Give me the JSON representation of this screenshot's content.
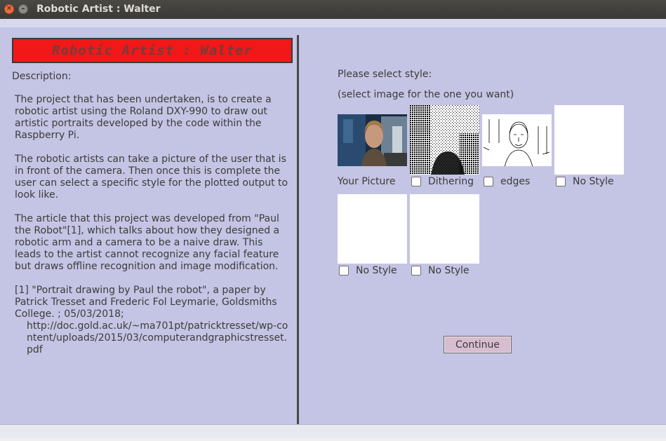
{
  "window": {
    "title": "Robotic Artist : Walter"
  },
  "banner": {
    "title": "Robotic Artist : Walter"
  },
  "description": {
    "label": "Description:",
    "paragraphs": [
      "The project that has been undertaken, is to create a robotic artist using the Roland DXY-990 to draw out artistic portraits developed by the code within the Raspberry Pi.",
      "The robotic artists can take a picture of the user that is in front of the camera. Then once this is complete the user can select a specific style for the plotted output to look like.",
      "The article that this project was developed from \"Paul the Robot\"[1], which talks about how they designed a robotic arm and a camera to be a naive draw. This leads to the artist cannot recognize any facial feature but draws offline recognition and image modification."
    ],
    "reference": "[1] \"Portrait drawing by Paul the robot\", a paper by Patrick Tresset and Frederic Fol Leymarie, Goldsmiths College. ; 05/03/2018;",
    "reference_url": "http://doc.gold.ac.uk/~ma701pt/patricktresset/wp-content/uploads/2015/03/computerandgraphicstresset.pdf"
  },
  "style_select": {
    "prompt": "Please select style:",
    "hint": "(select image for the one you want)",
    "options": [
      {
        "label": "Your Picture",
        "checkbox": false
      },
      {
        "label": "Dithering",
        "checkbox": true,
        "checked": false
      },
      {
        "label": "edges",
        "checkbox": true,
        "checked": false
      },
      {
        "label": "No Style",
        "checkbox": true,
        "checked": false
      },
      {
        "label": "No Style",
        "checkbox": true,
        "checked": false
      },
      {
        "label": "No Style",
        "checkbox": true,
        "checked": false
      }
    ]
  },
  "continue_label": "Continue"
}
